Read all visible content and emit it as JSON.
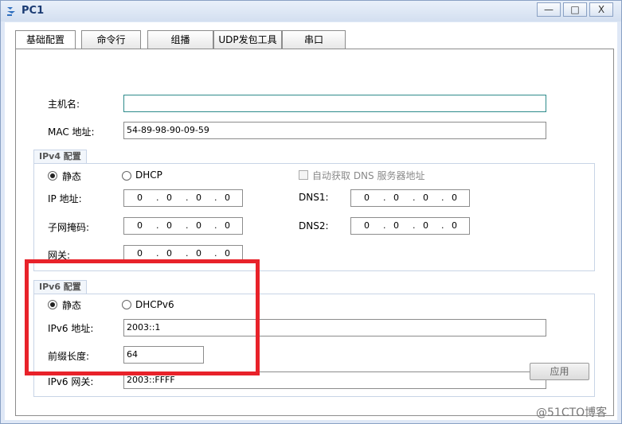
{
  "window": {
    "title": "PC1",
    "buttons": [
      "—",
      "□",
      "X"
    ]
  },
  "tabs": [
    "基础配置",
    "命令行",
    "组播",
    "UDP发包工具",
    "串口"
  ],
  "basic": {
    "hostname_label": "主机名:",
    "hostname_value": "",
    "mac_label": "MAC 地址:",
    "mac_value": "54-89-98-90-09-59"
  },
  "ipv4": {
    "group_title": "IPv4 配置",
    "static_label": "静态",
    "dhcp_label": "DHCP",
    "mode": "static",
    "auto_dns_label": "自动获取 DNS 服务器地址",
    "ip_label": "IP 地址:",
    "mask_label": "子网掩码:",
    "gateway_label": "网关:",
    "dns1_label": "DNS1:",
    "dns2_label": "DNS2:",
    "ip": [
      "0",
      ".",
      "0",
      ".",
      "0",
      ".",
      "0"
    ],
    "mask": [
      "0",
      ".",
      "0",
      ".",
      "0",
      ".",
      "0"
    ],
    "gateway": [
      "0",
      ".",
      "0",
      ".",
      "0",
      ".",
      "0"
    ],
    "dns1": [
      "0",
      ".",
      "0",
      ".",
      "0",
      ".",
      "0"
    ],
    "dns2": [
      "0",
      ".",
      "0",
      ".",
      "0",
      ".",
      "0"
    ]
  },
  "ipv6": {
    "group_title": "IPv6 配置",
    "static_label": "静态",
    "dhcp_label": "DHCPv6",
    "mode": "static",
    "addr_label": "IPv6 地址:",
    "addr_value": "2003::1",
    "prefix_label": "前缀长度:",
    "prefix_value": "64",
    "gateway_label": "IPv6 网关:",
    "gateway_value": "2003::FFFF"
  },
  "apply_label": "应用",
  "watermark": "@51CTO博客",
  "colors": {
    "highlight_box": "#e8222a",
    "window_frame": "#dfe8f6"
  }
}
